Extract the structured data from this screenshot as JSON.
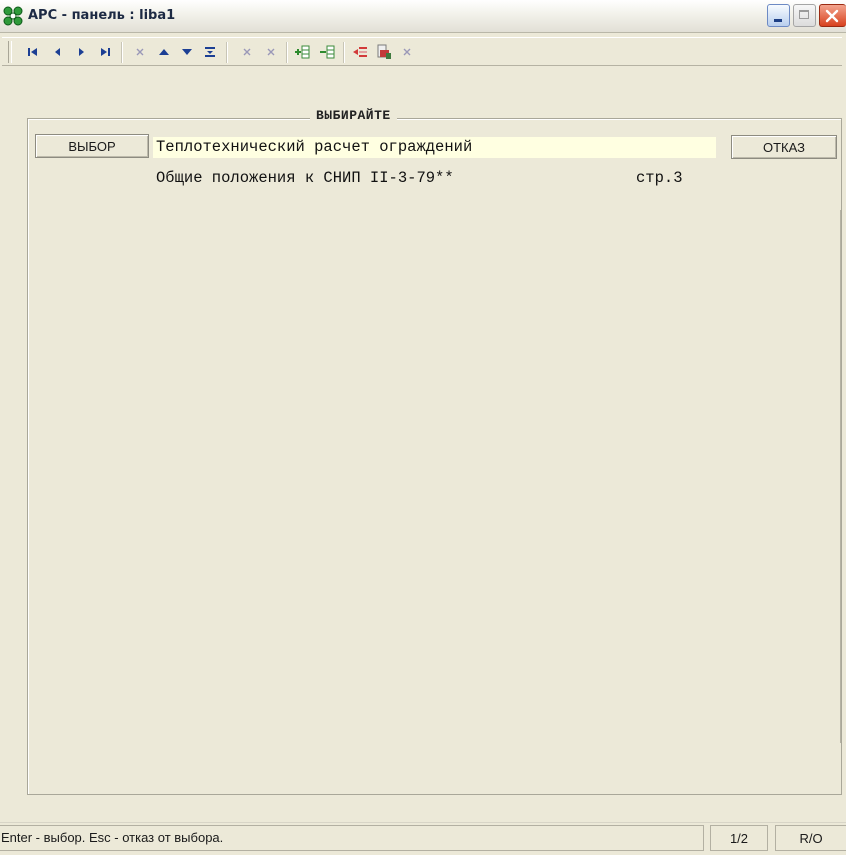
{
  "window": {
    "title": "АРС - панель : liba1",
    "icons": {
      "app": "flower-app-icon",
      "minimize": "minimize-icon",
      "maximize": "maximize-icon",
      "close": "close-icon"
    },
    "colors": {
      "close": "#d8421f",
      "minimize": "#b9cfee",
      "highlight_row": "#ffffe1"
    }
  },
  "toolbar": {
    "buttons": [
      "first-record-icon",
      "prev-record-icon",
      "next-record-icon",
      "last-record-icon",
      "delete-disabled-icon",
      "move-up-icon",
      "move-down-icon",
      "sum-icon",
      "cut-disabled-icon",
      "paste-disabled-icon",
      "insert-row-icon",
      "delete-row-icon",
      "exit-icon",
      "print-icon",
      "close-disabled-icon"
    ]
  },
  "panel": {
    "caption": "ВЫБИРАЙТЕ",
    "choose_label": "ВЫБОР",
    "cancel_label": "ОТКАЗ",
    "items": [
      {
        "text": "Теплотехнический расчет ограждений",
        "page": ""
      },
      {
        "text": "Общие положения к СНИП II-3-79**",
        "page": "стр.3"
      }
    ]
  },
  "status": {
    "message": "Enter - выбор. Esc - отказ от выбора.",
    "page": "1/2",
    "mode": "R/O"
  }
}
